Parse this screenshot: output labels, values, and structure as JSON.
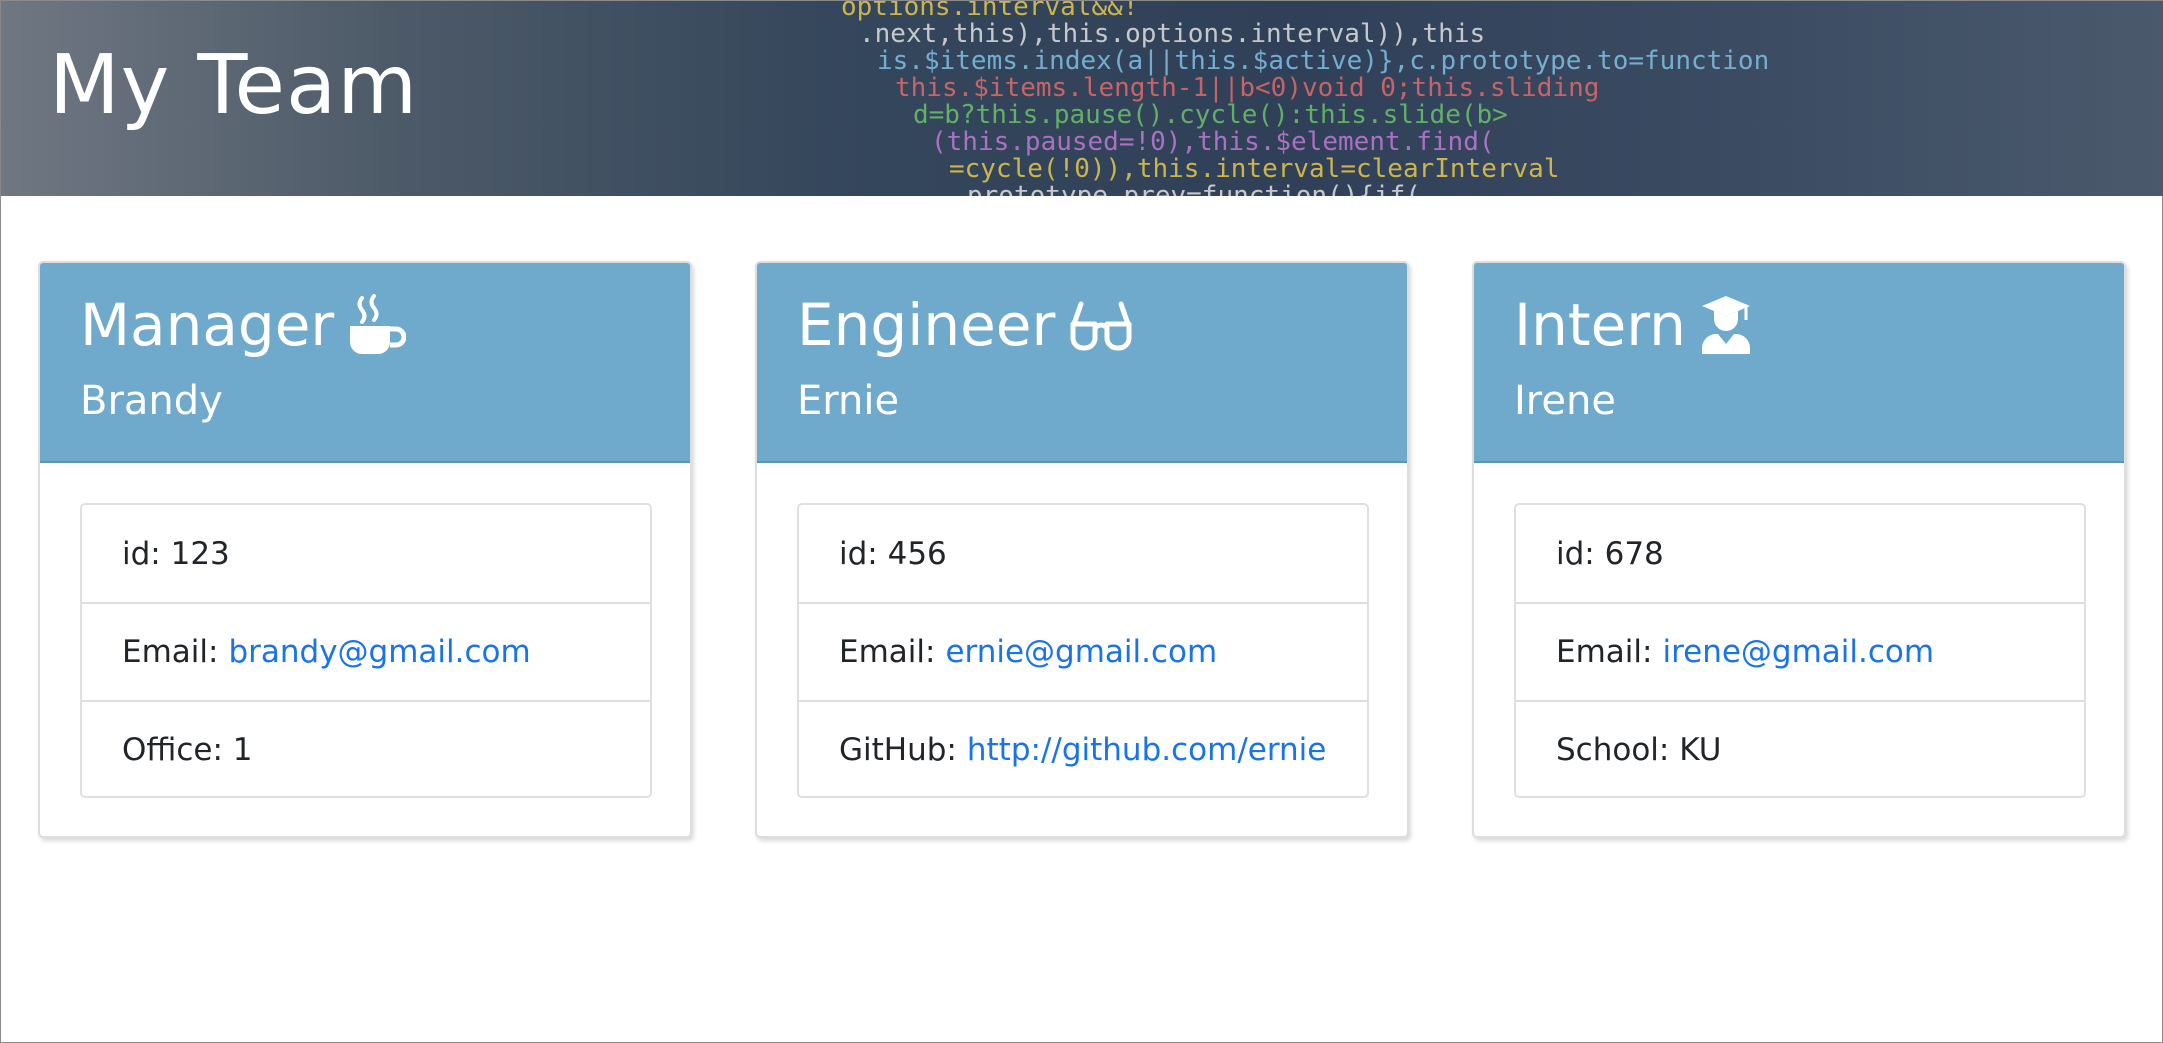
{
  "header": {
    "title": "My Team"
  },
  "hero_code_lines": [
    "options.interval&&!",
    ".next,this),this.options.interval)),this",
    "is.$items.index(a||this.$active)},c.prototype.to=function",
    "this.$items.length-1||b<0)void 0;this.sliding",
    "d=b?this.pause().cycle():this.slide(b>",
    "(this.paused=!0),this.$element.find(",
    "=cycle(!0)),this.interval=clearInterval",
    "prototype.prev=function(){if("
  ],
  "team": [
    {
      "role": "Manager",
      "icon": "coffee-icon",
      "name": "Brandy",
      "id_label": "id:",
      "id": "123",
      "email_label": "Email:",
      "email": "brandy@gmail.com",
      "extra_label": "Office:",
      "extra_value": "1",
      "extra_is_link": false
    },
    {
      "role": "Engineer",
      "icon": "glasses-icon",
      "name": "Ernie",
      "id_label": "id:",
      "id": "456",
      "email_label": "Email:",
      "email": "ernie@gmail.com",
      "extra_label": "GitHub:",
      "extra_value": "http://github.com/ernie",
      "extra_is_link": true
    },
    {
      "role": "Intern",
      "icon": "graduate-icon",
      "name": "Irene",
      "id_label": "id:",
      "id": "678",
      "email_label": "Email:",
      "email": "irene@gmail.com",
      "extra_label": "School:",
      "extra_value": "KU",
      "extra_is_link": false
    }
  ],
  "colors": {
    "card_header": "#6fa9cb",
    "link": "#1a73e8",
    "hero_code": [
      "#e8c84a",
      "#e0e0e0",
      "#7fc1e6",
      "#e06a6a",
      "#6ac36a",
      "#c07ad6"
    ]
  }
}
